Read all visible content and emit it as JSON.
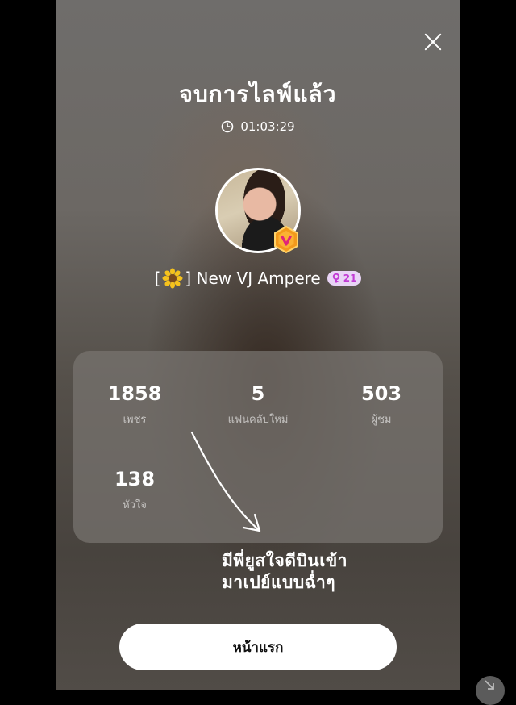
{
  "stream_end": {
    "title": "จบการไลฟ์แล้ว",
    "duration": "01:03:29",
    "close_icon": "close-icon",
    "clock_icon": "clock-icon"
  },
  "profile": {
    "name_prefix": "[",
    "flower_icon": "sunflower-emoji",
    "name_suffix": "] New VJ Ampere",
    "level": "21",
    "badge_icon": "v-hexagon-badge"
  },
  "stats": [
    {
      "value": "1858",
      "label": "เพชร"
    },
    {
      "value": "5",
      "label": "แฟนคลับใหม่"
    },
    {
      "value": "503",
      "label": "ผู้ชม"
    },
    {
      "value": "138",
      "label": "หัวใจ"
    }
  ],
  "annotation": {
    "line1": "มีพี่ยูสใจดีบินเข้า",
    "line2": "มาเปย์แบบฉ่ำๆ"
  },
  "home_button": {
    "label": "หน้าแรก"
  },
  "colors": {
    "level_bg": "#e9d4f6",
    "level_text": "#c23bd4",
    "badge_orange": "#f39a1c"
  }
}
